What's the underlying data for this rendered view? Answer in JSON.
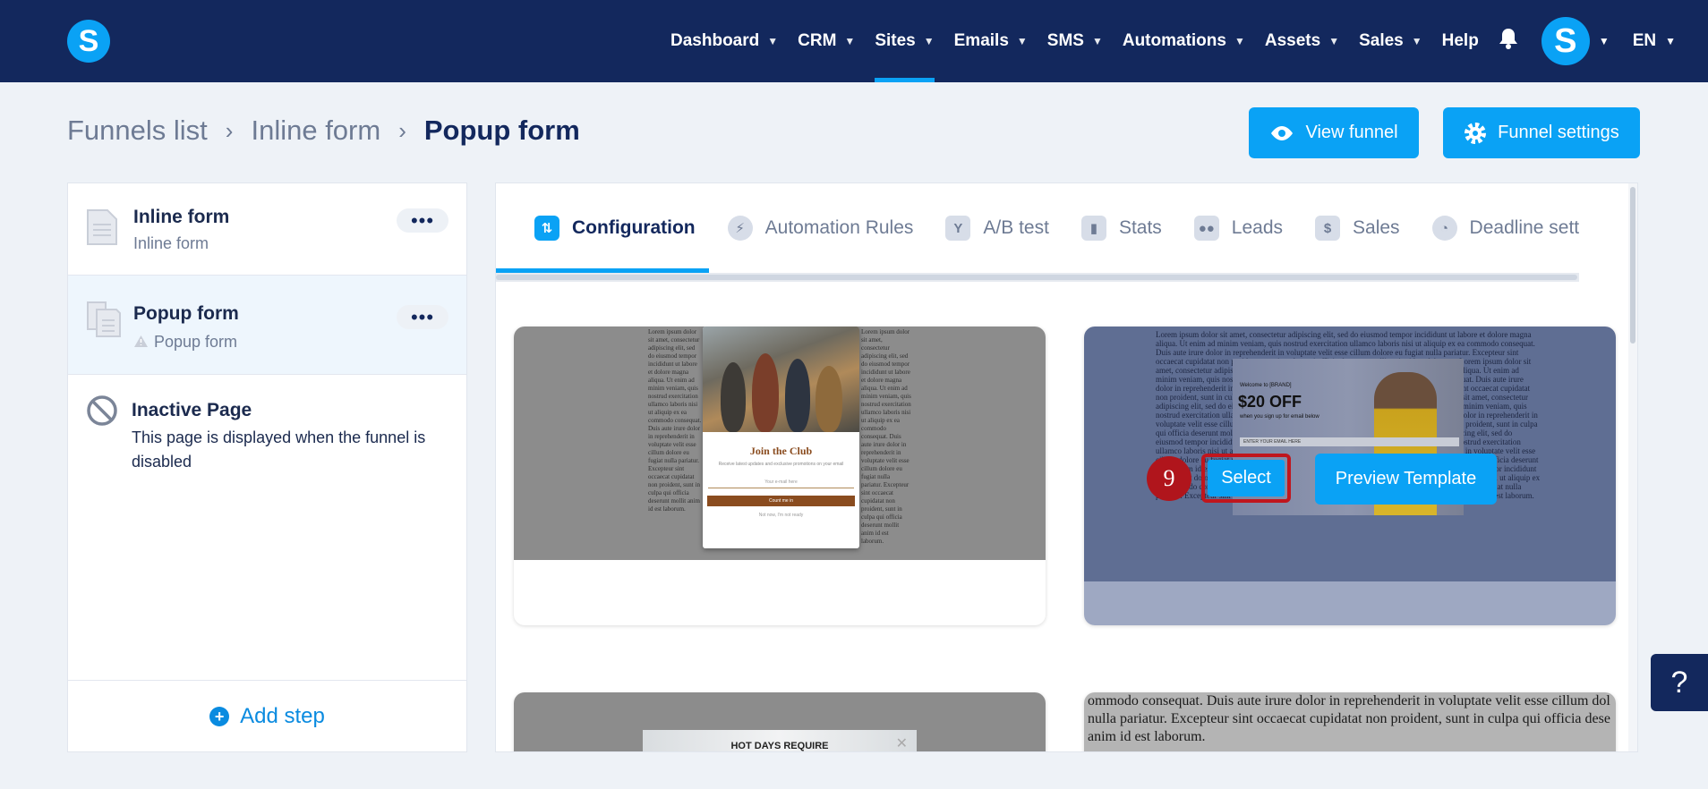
{
  "app": {
    "logo_letter": "S",
    "avatar_letter": "S",
    "language": "EN"
  },
  "nav": {
    "items": [
      {
        "label": "Dashboard",
        "has_dropdown": true
      },
      {
        "label": "CRM",
        "has_dropdown": true
      },
      {
        "label": "Sites",
        "has_dropdown": true,
        "active": true
      },
      {
        "label": "Emails",
        "has_dropdown": true
      },
      {
        "label": "SMS",
        "has_dropdown": true
      },
      {
        "label": "Automations",
        "has_dropdown": true
      },
      {
        "label": "Assets",
        "has_dropdown": true
      },
      {
        "label": "Sales",
        "has_dropdown": true
      },
      {
        "label": "Help",
        "has_dropdown": false
      }
    ]
  },
  "breadcrumb": [
    "Funnels list",
    "Inline form",
    "Popup form"
  ],
  "header_buttons": {
    "view_funnel": "View funnel",
    "funnel_settings": "Funnel settings"
  },
  "sidebar": {
    "steps": [
      {
        "title": "Inline form",
        "subtitle": "Inline form"
      },
      {
        "title": "Popup form",
        "subtitle": "Popup form",
        "warning": true
      }
    ],
    "inactive": {
      "title": "Inactive Page",
      "description": "This page is displayed when the funnel is disabled"
    },
    "add_step": "Add step"
  },
  "tabs": [
    {
      "label": "Configuration",
      "active": true
    },
    {
      "label": "Automation Rules"
    },
    {
      "label": "A/B test"
    },
    {
      "label": "Stats"
    },
    {
      "label": "Leads"
    },
    {
      "label": "Sales"
    },
    {
      "label": "Deadline sett"
    }
  ],
  "templates": {
    "card1": {
      "popup_title": "Join the Club",
      "popup_sub": "Receive latest updates and exclusive promotions on your email",
      "field_placeholder": "Your e-mail here",
      "cta": "Count me in",
      "decline": "Not now, I'm not ready"
    },
    "card2": {
      "welcome": "Welcome to [BRAND]",
      "offer": "$20 OFF",
      "when": "when you sign up for email below",
      "email_placeholder": "ENTER YOUR EMAIL HERE",
      "badge": "9",
      "select": "Select",
      "preview": "Preview Template"
    },
    "card3": {
      "headline": "HOT DAYS REQUIRE"
    },
    "card4": {
      "text_line1": "ommodo consequat. Duis aute irure dolor in reprehenderit in voluptate velit esse cillum dol",
      "text_line2": "nulla pariatur. Excepteur sint occaecat cupidatat non proident, sunt in culpa qui officia dese",
      "text_line3": "anim id est laborum."
    },
    "lorem_short": "Lorem ipsum dolor sit amet, consectetur adipiscing elit, sed do eiusmod tempor incididunt ut labore et dolore magna aliqua. Ut enim ad minim veniam, quis nostrud exercitation ullamco laboris nisi ut aliquip ex ea commodo consequat. Duis aute irure dolor in reprehenderit in voluptate velit esse cillum dolore eu fugiat nulla pariatur. Excepteur sint occaecat cupidatat non proident, sunt in culpa qui officia deserunt mollit anim id est laborum."
  },
  "help": {
    "label": "?"
  },
  "colors": {
    "nav_bg": "#13285d",
    "accent": "#0aa2f5",
    "highlight": "#c0161d"
  }
}
